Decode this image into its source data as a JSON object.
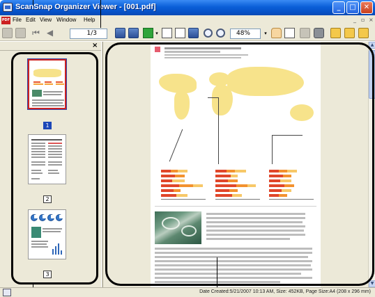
{
  "window": {
    "title": "ScanSnap Organizer Viewer - [001.pdf]",
    "minimize_glyph": "_",
    "maximize_glyph": "□",
    "close_glyph": "✕"
  },
  "menubar": {
    "app_badge": "PDF",
    "items": [
      "File",
      "Edit",
      "View",
      "Window",
      "Help"
    ],
    "doc_controls": [
      "_",
      "▫",
      "×"
    ]
  },
  "toolbar": {
    "page_indicator": "1/3",
    "zoom_value": "48%",
    "icons": [
      "save-icon",
      "print-icon",
      "first-page-icon",
      "previous-page-icon",
      "next-page-icon",
      "last-page-icon",
      "display-mode-icon",
      "fit-width-icon",
      "fit-page-icon",
      "single-page-icon",
      "zoom-in-icon",
      "zoom-out-icon",
      "hand-tool-icon",
      "zoom-area-icon",
      "undo-icon",
      "delete-icon",
      "rotate-left-icon",
      "rotate-180-icon",
      "rotate-right-icon"
    ]
  },
  "thumbnail_panel": {
    "close_glyph": "×",
    "pages": [
      {
        "number": "1",
        "selected": true
      },
      {
        "number": "2",
        "selected": false
      },
      {
        "number": "3",
        "selected": false
      }
    ]
  },
  "status_bar": {
    "text": "Date Created:5/21/2007 10:13 AM, Size: 452KB, Page Size:A4 (208 x 296 mm)"
  },
  "colors": {
    "title_bar": "#0a5fd8",
    "chrome": "#ece9d8",
    "selection_border": "#cc2222",
    "map_fill": "#f7e38b"
  }
}
